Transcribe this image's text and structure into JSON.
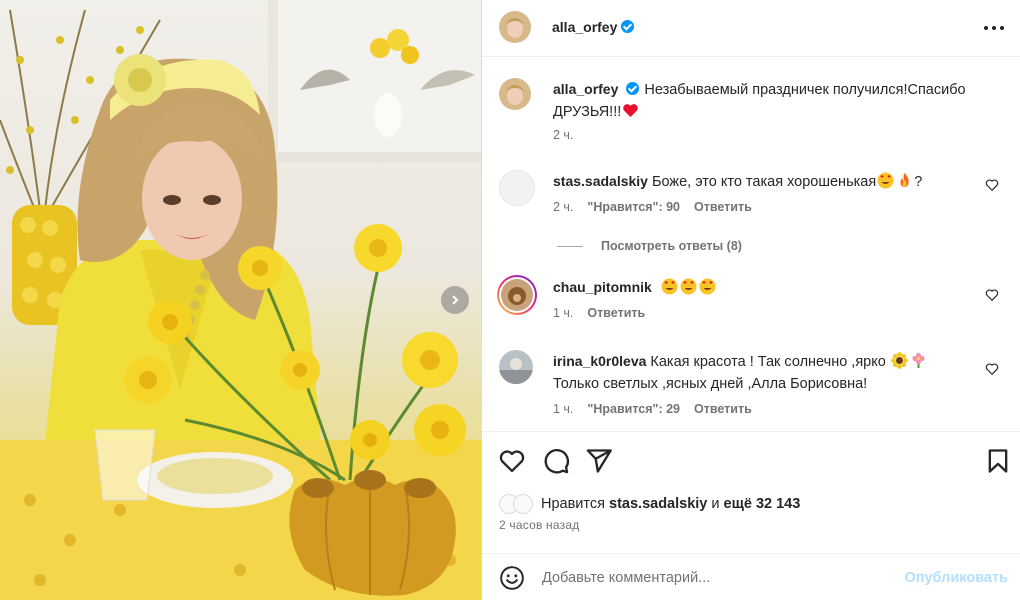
{
  "post": {
    "author": "alla_orfey",
    "caption": "Незабываемый праздничек получился!Спасибо ДРУЗЬЯ!!!",
    "caption_time": "2 ч."
  },
  "comments": [
    {
      "user": "stas.sadalskiy",
      "text": "Боже, это кто такая хорошенькая",
      "trailing": "?",
      "time": "2 ч.",
      "likes": "\"Нравится\": 90",
      "reply": "Ответить"
    },
    {
      "user": "chau_pitomnik",
      "text": "",
      "time": "1 ч.",
      "reply": "Ответить"
    },
    {
      "user": "irina_k0r0leva",
      "text": "Какая красота ! Так солнечно ,ярко",
      "text2": "Только светлых ,ясных дней ,Алла Борисовна!",
      "time": "1 ч.",
      "likes": "\"Нравится\": 29",
      "reply": "Ответить"
    }
  ],
  "view_replies": "Посмотреть ответы (8)",
  "likes": {
    "prefix": "Нравится",
    "user": "stas.sadalskiy",
    "middle": "и",
    "rest": "ещё 32 143"
  },
  "time_ago": "2 часов назад",
  "add_comment": {
    "placeholder": "Добавьте комментарий...",
    "publish": "Опубликовать"
  },
  "colors": {
    "verified": "#0095f6",
    "heart": "#e8112d",
    "publish_disabled": "#b2dffc",
    "secondary_text": "#737373"
  },
  "icons": [
    "verified-icon",
    "more-options-icon",
    "like-icon",
    "comment-icon",
    "share-icon",
    "save-icon",
    "emoji-icon",
    "next-image-icon",
    "heart-emoji",
    "heart-eyes-emoji",
    "fire-emoji",
    "sunflower-emoji",
    "flower-emoji"
  ]
}
